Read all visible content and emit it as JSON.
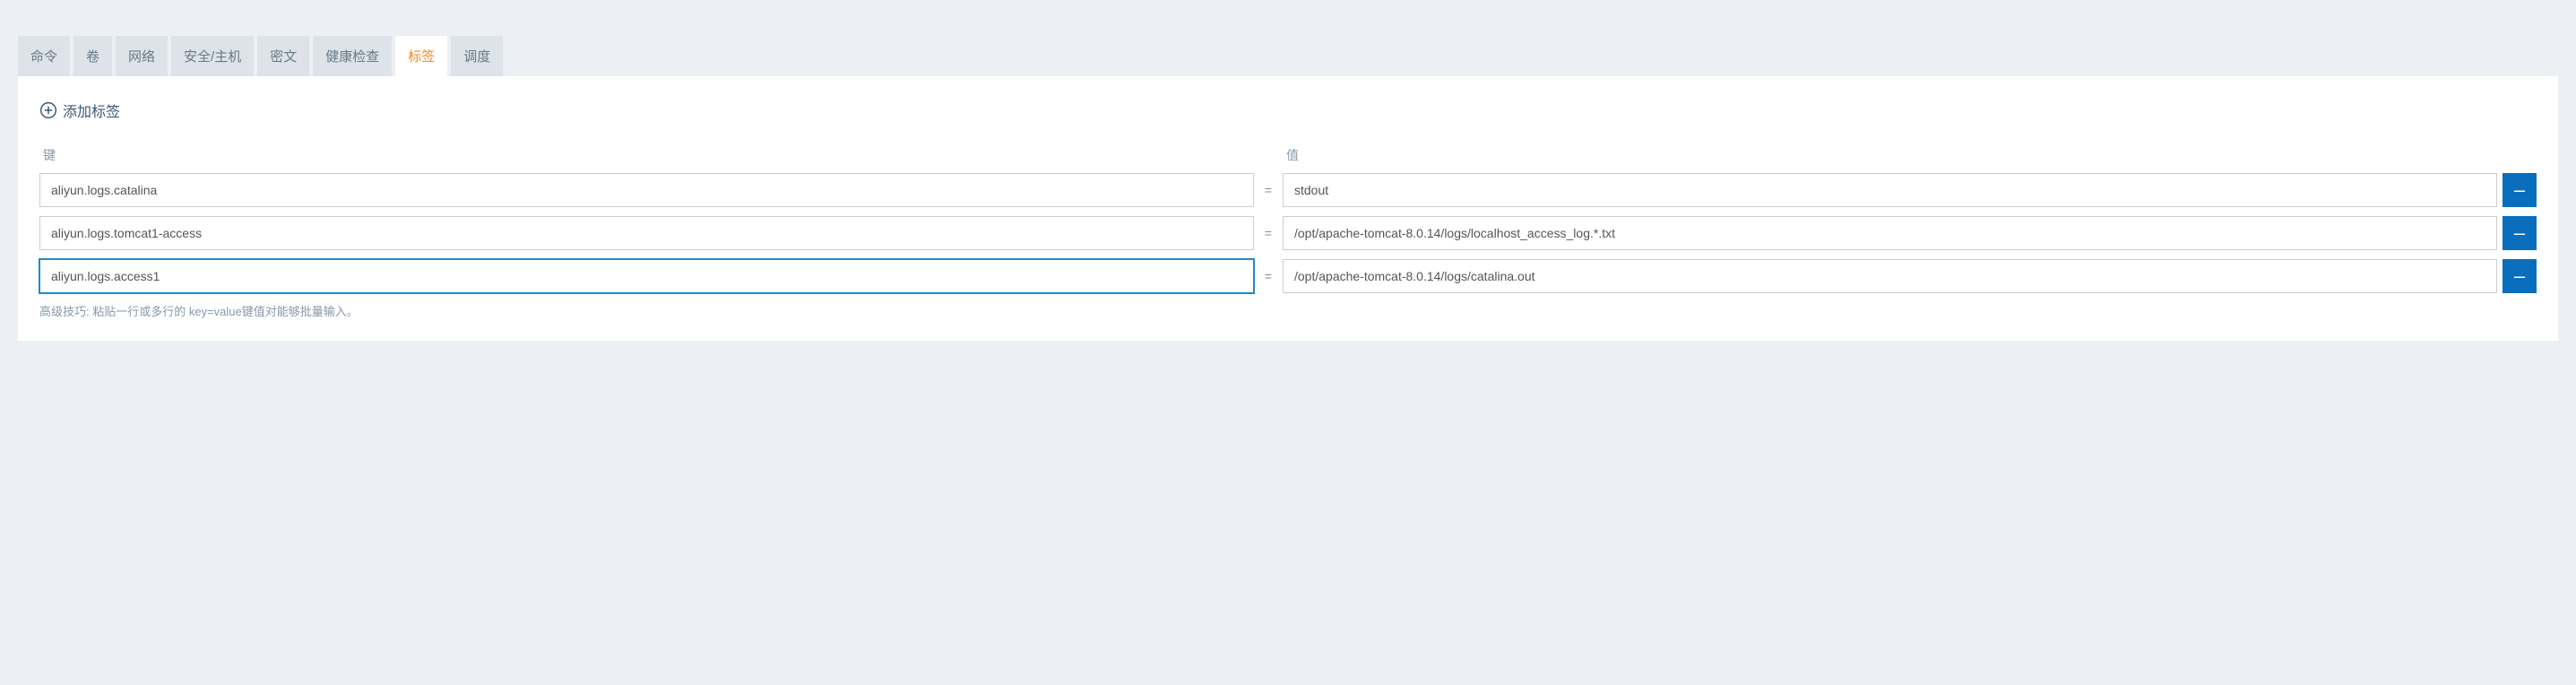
{
  "tabs": [
    {
      "label": "命令",
      "active": false
    },
    {
      "label": "卷",
      "active": false
    },
    {
      "label": "网络",
      "active": false
    },
    {
      "label": "安全/主机",
      "active": false
    },
    {
      "label": "密文",
      "active": false
    },
    {
      "label": "健康检查",
      "active": false
    },
    {
      "label": "标签",
      "active": true
    },
    {
      "label": "调度",
      "active": false
    }
  ],
  "add_label_text": "添加标签",
  "headers": {
    "key": "键",
    "value": "值"
  },
  "rows": [
    {
      "key": "aliyun.logs.catalina",
      "value": "stdout",
      "focused": false
    },
    {
      "key": "aliyun.logs.tomcat1-access",
      "value": "/opt/apache-tomcat-8.0.14/logs/localhost_access_log.*.txt",
      "focused": false
    },
    {
      "key": "aliyun.logs.access1",
      "value": "/opt/apache-tomcat-8.0.14/logs/catalina.out",
      "focused": true
    }
  ],
  "hint": "高级技巧: 粘贴一行或多行的 key=value键值对能够批量输入。",
  "equals_sign": "=",
  "minus_sign": "–"
}
